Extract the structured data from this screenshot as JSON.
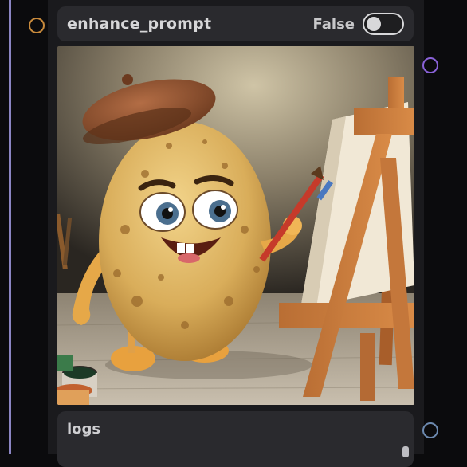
{
  "widget": {
    "name": "enhance_prompt",
    "value": "False",
    "enabled": false
  },
  "output_image": {
    "subject": "cartoon potato painter with beret at easel"
  },
  "logs": {
    "label": "logs"
  },
  "colors": {
    "input_port": "#c88a3c",
    "output_port": "#8a62d8",
    "logs_port": "#6d8ab0",
    "frame_line": "#9a93d8"
  }
}
